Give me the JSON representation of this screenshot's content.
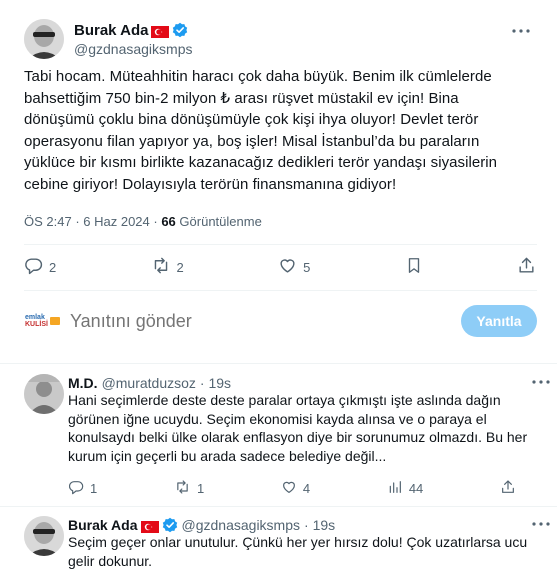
{
  "main_tweet": {
    "author_name": "Burak Ada",
    "handle": "@gzdnasagiksmps",
    "body_lines": [
      "Tabi hocam. Müteahhitin haracı çok daha büyük. Benim ilk cümlelerde",
      "bahsettiğim 750 bin-2 milyon ₺ arası rüşvet müstakil ev için! Bina",
      "dönüşümü çoklu bina dönüşümüyle çok kişi ihya oluyor! Devlet terör",
      "operasyonu filan yapıyor ya, boş işler! Misal İstanbul’da bu paraların",
      "yüklüce bir kısmı birlikte kazanacağız dedikleri terör yandaşı siyasilerin",
      "cebine giriyor! Dolayısıyla terörün finansmanına gidiyor!"
    ],
    "time": "ÖS 2:47",
    "date": "6 Haz 2024",
    "separator": " · ",
    "views_count": "66",
    "views_label": "Görüntülenme",
    "replies": "2",
    "reposts": "2",
    "likes": "5"
  },
  "composer": {
    "avatar_line1": "emlak",
    "avatar_line2": "KULİSİ",
    "placeholder": "Yanıtını gönder",
    "button_label": "Yanıtla"
  },
  "replies": [
    {
      "author_name": "M.D.",
      "handle": "@muratduzsoz",
      "time": "· 19s",
      "body_lines": [
        "Hani seçimlerde deste deste paralar ortaya çıkmıştı işte aslında dağın",
        "görünen iğne ucuydu. Seçim ekonomisi kayda alınsa ve o paraya el",
        "konulsaydı belki ülke olarak enflasyon diye bir sorunumuz olmazdı. Bu her",
        "kurum için geçerli bu arada sadece belediye değil..."
      ],
      "replies": "1",
      "reposts": "1",
      "likes": "4",
      "views": "44"
    },
    {
      "author_name": "Burak Ada",
      "handle": "@gzdnasagiksmps",
      "time": "· 19s",
      "body_lines": [
        "Seçim geçer onlar unutulur. Çünkü her yer hırsız dolu! Çok uzatırlarsa ucu",
        "gelir dokunur."
      ]
    }
  ],
  "colors": {
    "text": "#0f1419",
    "secondary": "#536471",
    "accent": "#1d9bf0",
    "button_disabled": "#8ecdf7",
    "divider": "#eff3f4",
    "flag_red": "#e30a17"
  },
  "icons": [
    "more-icon",
    "verified-icon",
    "flag-tr-icon",
    "reply-icon",
    "repost-icon",
    "like-icon",
    "bookmark-icon",
    "share-icon",
    "views-icon"
  ]
}
